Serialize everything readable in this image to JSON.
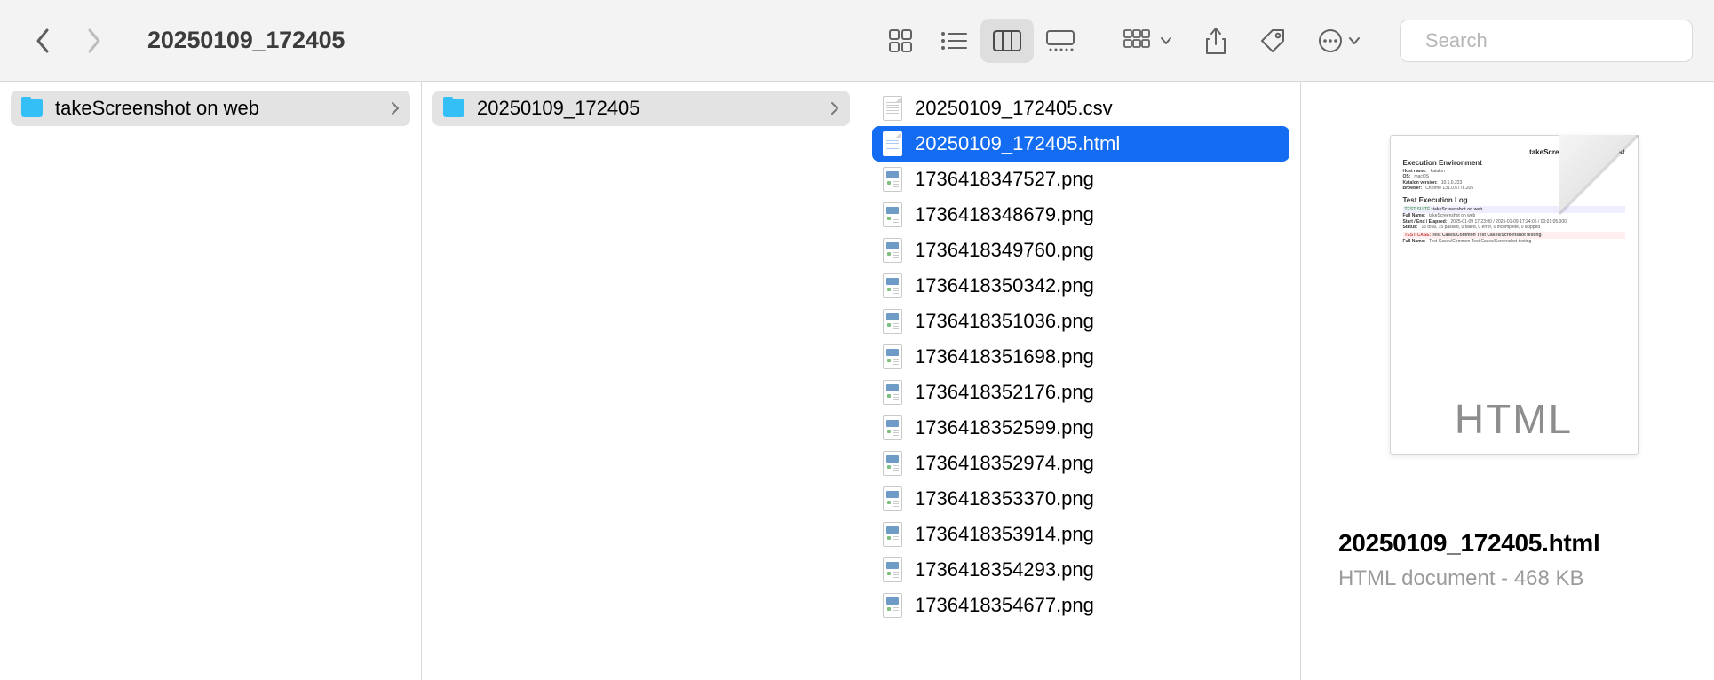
{
  "breadcrumb_title": "20250109_172405",
  "search": {
    "placeholder": "Search"
  },
  "columns": {
    "col1": [
      {
        "name": "takeScreenshot on web",
        "type": "folder",
        "has_children": true,
        "active": true
      }
    ],
    "col2": [
      {
        "name": "20250109_172405",
        "type": "folder",
        "has_children": true,
        "active": true
      }
    ],
    "col3": [
      {
        "name": "20250109_172405.csv",
        "type": "generic",
        "selected": false
      },
      {
        "name": "20250109_172405.html",
        "type": "generic",
        "selected": true
      },
      {
        "name": "1736418347527.png",
        "type": "image",
        "selected": false
      },
      {
        "name": "1736418348679.png",
        "type": "image",
        "selected": false
      },
      {
        "name": "1736418349760.png",
        "type": "image",
        "selected": false
      },
      {
        "name": "1736418350342.png",
        "type": "image",
        "selected": false
      },
      {
        "name": "1736418351036.png",
        "type": "image",
        "selected": false
      },
      {
        "name": "1736418351698.png",
        "type": "image",
        "selected": false
      },
      {
        "name": "1736418352176.png",
        "type": "image",
        "selected": false
      },
      {
        "name": "1736418352599.png",
        "type": "image",
        "selected": false
      },
      {
        "name": "1736418352974.png",
        "type": "image",
        "selected": false
      },
      {
        "name": "1736418353370.png",
        "type": "image",
        "selected": false
      },
      {
        "name": "1736418353914.png",
        "type": "image",
        "selected": false
      },
      {
        "name": "1736418354293.png",
        "type": "image",
        "selected": false
      },
      {
        "name": "1736418354677.png",
        "type": "image",
        "selected": false
      }
    ]
  },
  "preview": {
    "html_label": "HTML",
    "title": "20250109_172405.html",
    "meta": "HTML document - 468 KB",
    "doc": {
      "heading_right": "takeScreenshot on web Test",
      "section1": "Execution Environment",
      "env_rows": [
        [
          "Host name",
          "katalon"
        ],
        [
          "OS",
          "macOS"
        ],
        [
          "Katalon version",
          "10.1.0.223"
        ],
        [
          "Browser",
          "Chrome 131.0.6778.205"
        ]
      ],
      "section2": "Test Execution Log",
      "suite_label": "TEST SUITE:",
      "suite_name": "takeScreenshot on web",
      "log_rows": [
        [
          "Full Name",
          "takeScreenshot on web"
        ],
        [
          "Start / End / Elapsed",
          "2025-01-09 17:23:00 / 2025-01-09 17:24:05 / 00:01:05.000"
        ],
        [
          "Status",
          "15 total, 15 passed, 0 failed, 0 error, 0 incomplete, 0 skipped"
        ]
      ],
      "testcase_label": "TEST CASE:",
      "testcase_name": "Test Cases/Common Test Cases/Screenshot testing",
      "tc_rows": [
        [
          "Full Name",
          "Test Cases/Common Test Cases/Screenshot testing"
        ]
      ]
    }
  }
}
